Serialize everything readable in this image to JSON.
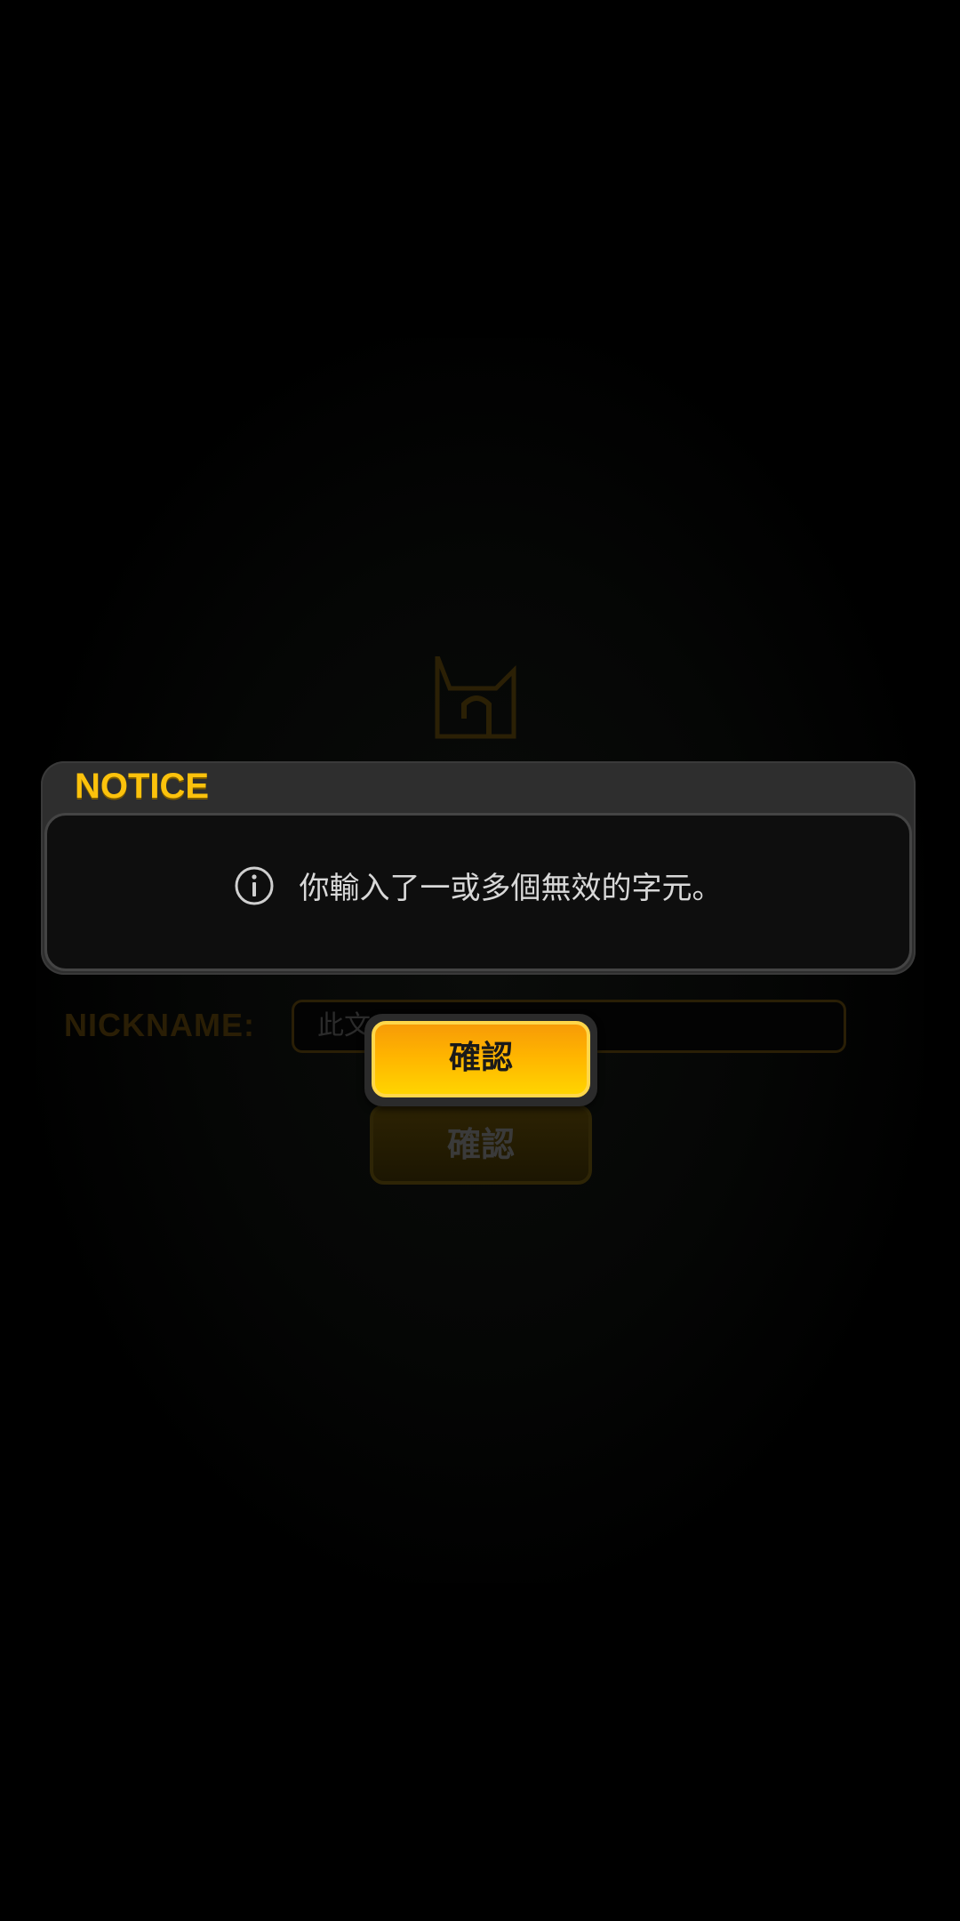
{
  "background": {
    "nickname_label": "NICKNAME:",
    "nickname_placeholder": "此文",
    "confirm_label": "確認",
    "logo_icon": "game-logo-icon"
  },
  "dialog": {
    "title": "NOTICE",
    "icon": "info-icon",
    "message": "你輸入了一或多個無效的字元。",
    "confirm_label": "確認"
  },
  "colors": {
    "title_yellow": "#fcc20c",
    "button_orange": "#f79b07",
    "button_yellow": "#ffd400",
    "dialog_frame": "#2e2e2e",
    "dialog_body": "#0e0e0e"
  }
}
